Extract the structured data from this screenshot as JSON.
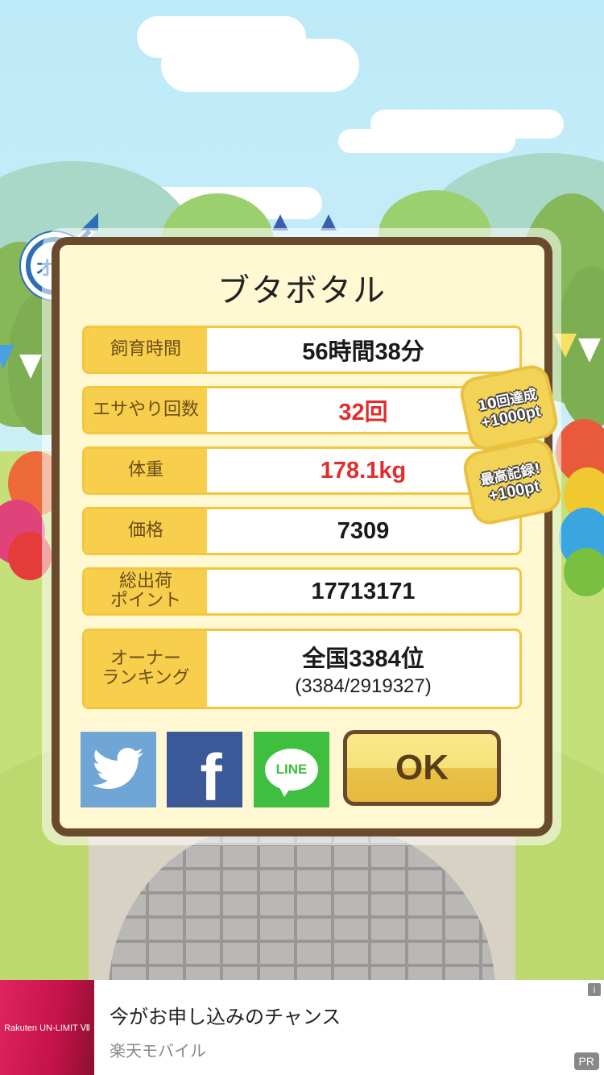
{
  "pet": {
    "name": "ブタボタル",
    "gender_badge": "オス"
  },
  "stats": [
    {
      "label": "飼育時間",
      "value": "56時間38分",
      "highlight": false
    },
    {
      "label": "エサやり回数",
      "value": "32回",
      "highlight": true
    },
    {
      "label": "体重",
      "value": "178.1kg",
      "highlight": true
    },
    {
      "label": "価格",
      "value": "7309",
      "highlight": false
    },
    {
      "label": "総出荷\nポイント",
      "value": "17713171",
      "highlight": false
    },
    {
      "label": "オーナー\nランキング",
      "value": "全国3384位",
      "sub": "(3384/2919327)",
      "highlight": false
    }
  ],
  "bonuses": [
    {
      "title": "10回達成",
      "points": "+1000pt"
    },
    {
      "title": "最高記録!",
      "points": "+100pt"
    }
  ],
  "share": {
    "twitter_icon": "twitter-bird-icon",
    "facebook_icon": "facebook-f-icon",
    "facebook_glyph": "f",
    "line_icon": "line-icon",
    "line_text": "LINE"
  },
  "ok_label": "OK",
  "ad": {
    "brand_logo": "Rakuten UN-LIMIT Ⅶ",
    "title": "今がお申し込みのチャンス",
    "advertiser": "楽天モバイル",
    "pr_label": "PR",
    "info_label": "i"
  },
  "colors": {
    "dialog_border": "#6a4a2c",
    "dialog_bg": "#fff8d2",
    "label_bg": "#f7cf4c",
    "highlight_text": "#e02e2e",
    "gender_blue": "#2c6fb8"
  }
}
